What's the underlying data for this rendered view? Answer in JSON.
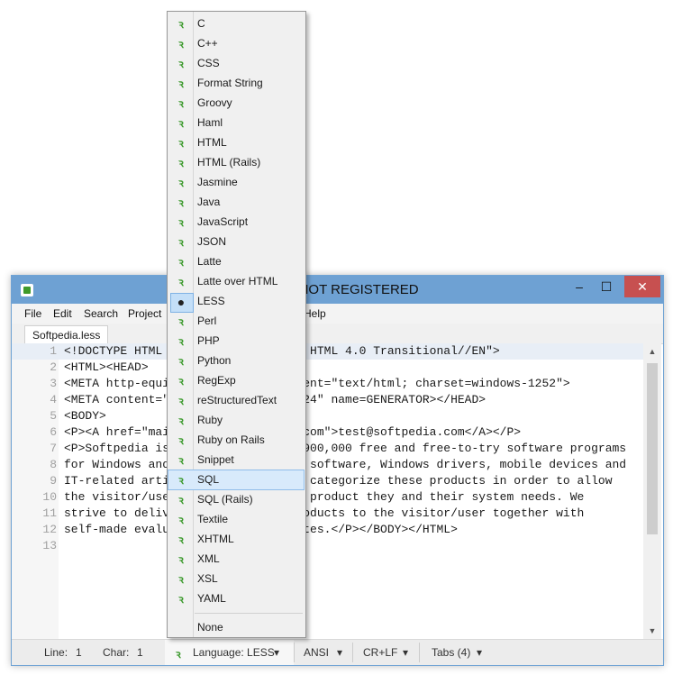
{
  "window": {
    "title": "Softpedia\\ - Intype  - NOT REGISTERED",
    "controls": {
      "minimize": "–",
      "maximize": "☐",
      "close": "✕"
    }
  },
  "menubar": [
    "File",
    "Edit",
    "Search",
    "Project",
    "Help"
  ],
  "tab": {
    "label": "Softpedia.less"
  },
  "editor": {
    "lines": [
      {
        "n": "1",
        "text": "<!DOCTYPE HTML PUBLIC \"-//W3C//DTD HTML 4.0 Transitional//EN\">"
      },
      {
        "n": "2",
        "text": "<HTML><HEAD>"
      },
      {
        "n": "3",
        "text": "<META http-equiv=Content-Type content=\"text/html; charset=windows-1252\">"
      },
      {
        "n": "4",
        "text": "<META content=\"MSHTML 6.00.2900.3024\" name=GENERATOR></HEAD>"
      },
      {
        "n": "5",
        "text": "<BODY>"
      },
      {
        "n": "6",
        "text": "<P><A href=\"mailto:test@softpedia.com\">test@softpedia.com</A></P>"
      },
      {
        "n": "7",
        "text": "<P>Softpedia is a library of over 900,000 free and free-to-try software programs"
      },
      {
        "n": "8",
        "text": "for Windows and Unix/Linux, games, software, Windows drivers, mobile devices and"
      },
      {
        "n": "9",
        "text": "IT-related articles. We review and categorize these products in order to allow"
      },
      {
        "n": "10",
        "text": "the visitor/user to find the exact product they and their system needs. We"
      },
      {
        "n": "11",
        "text": "strive to deliver only the best products to the visitor/user together with"
      },
      {
        "n": "12",
        "text": "self-made evaluation and review notes.</P></BODY></HTML>"
      },
      {
        "n": "13",
        "text": ""
      }
    ]
  },
  "statusbar": {
    "line_label": "Line:",
    "line_value": "1",
    "char_label": "Char:",
    "char_value": "1",
    "language": "Language: LESS",
    "encoding": "ANSI",
    "line_ending": "CR+LF",
    "tabs": "Tabs (4)",
    "dropdown_arrow": "▾"
  },
  "language_menu": {
    "items": [
      "C",
      "C++",
      "CSS",
      "Format String",
      "Groovy",
      "Haml",
      "HTML",
      "HTML (Rails)",
      "Jasmine",
      "Java",
      "JavaScript",
      "JSON",
      "Latte",
      "Latte over HTML",
      "LESS",
      "Perl",
      "PHP",
      "Python",
      "RegExp",
      "reStructuredText",
      "Ruby",
      "Ruby on Rails",
      "Snippet",
      "SQL",
      "SQL (Rails)",
      "Textile",
      "XHTML",
      "XML",
      "XSL",
      "YAML"
    ],
    "checked": "LESS",
    "hovered": "SQL",
    "none_label": "None",
    "item_icon": "ꝛ",
    "check_icon": "●"
  },
  "colors": {
    "titlebar": "#6ea1d3",
    "accent": "#3d9a2e",
    "hover": "#d8eafb"
  }
}
